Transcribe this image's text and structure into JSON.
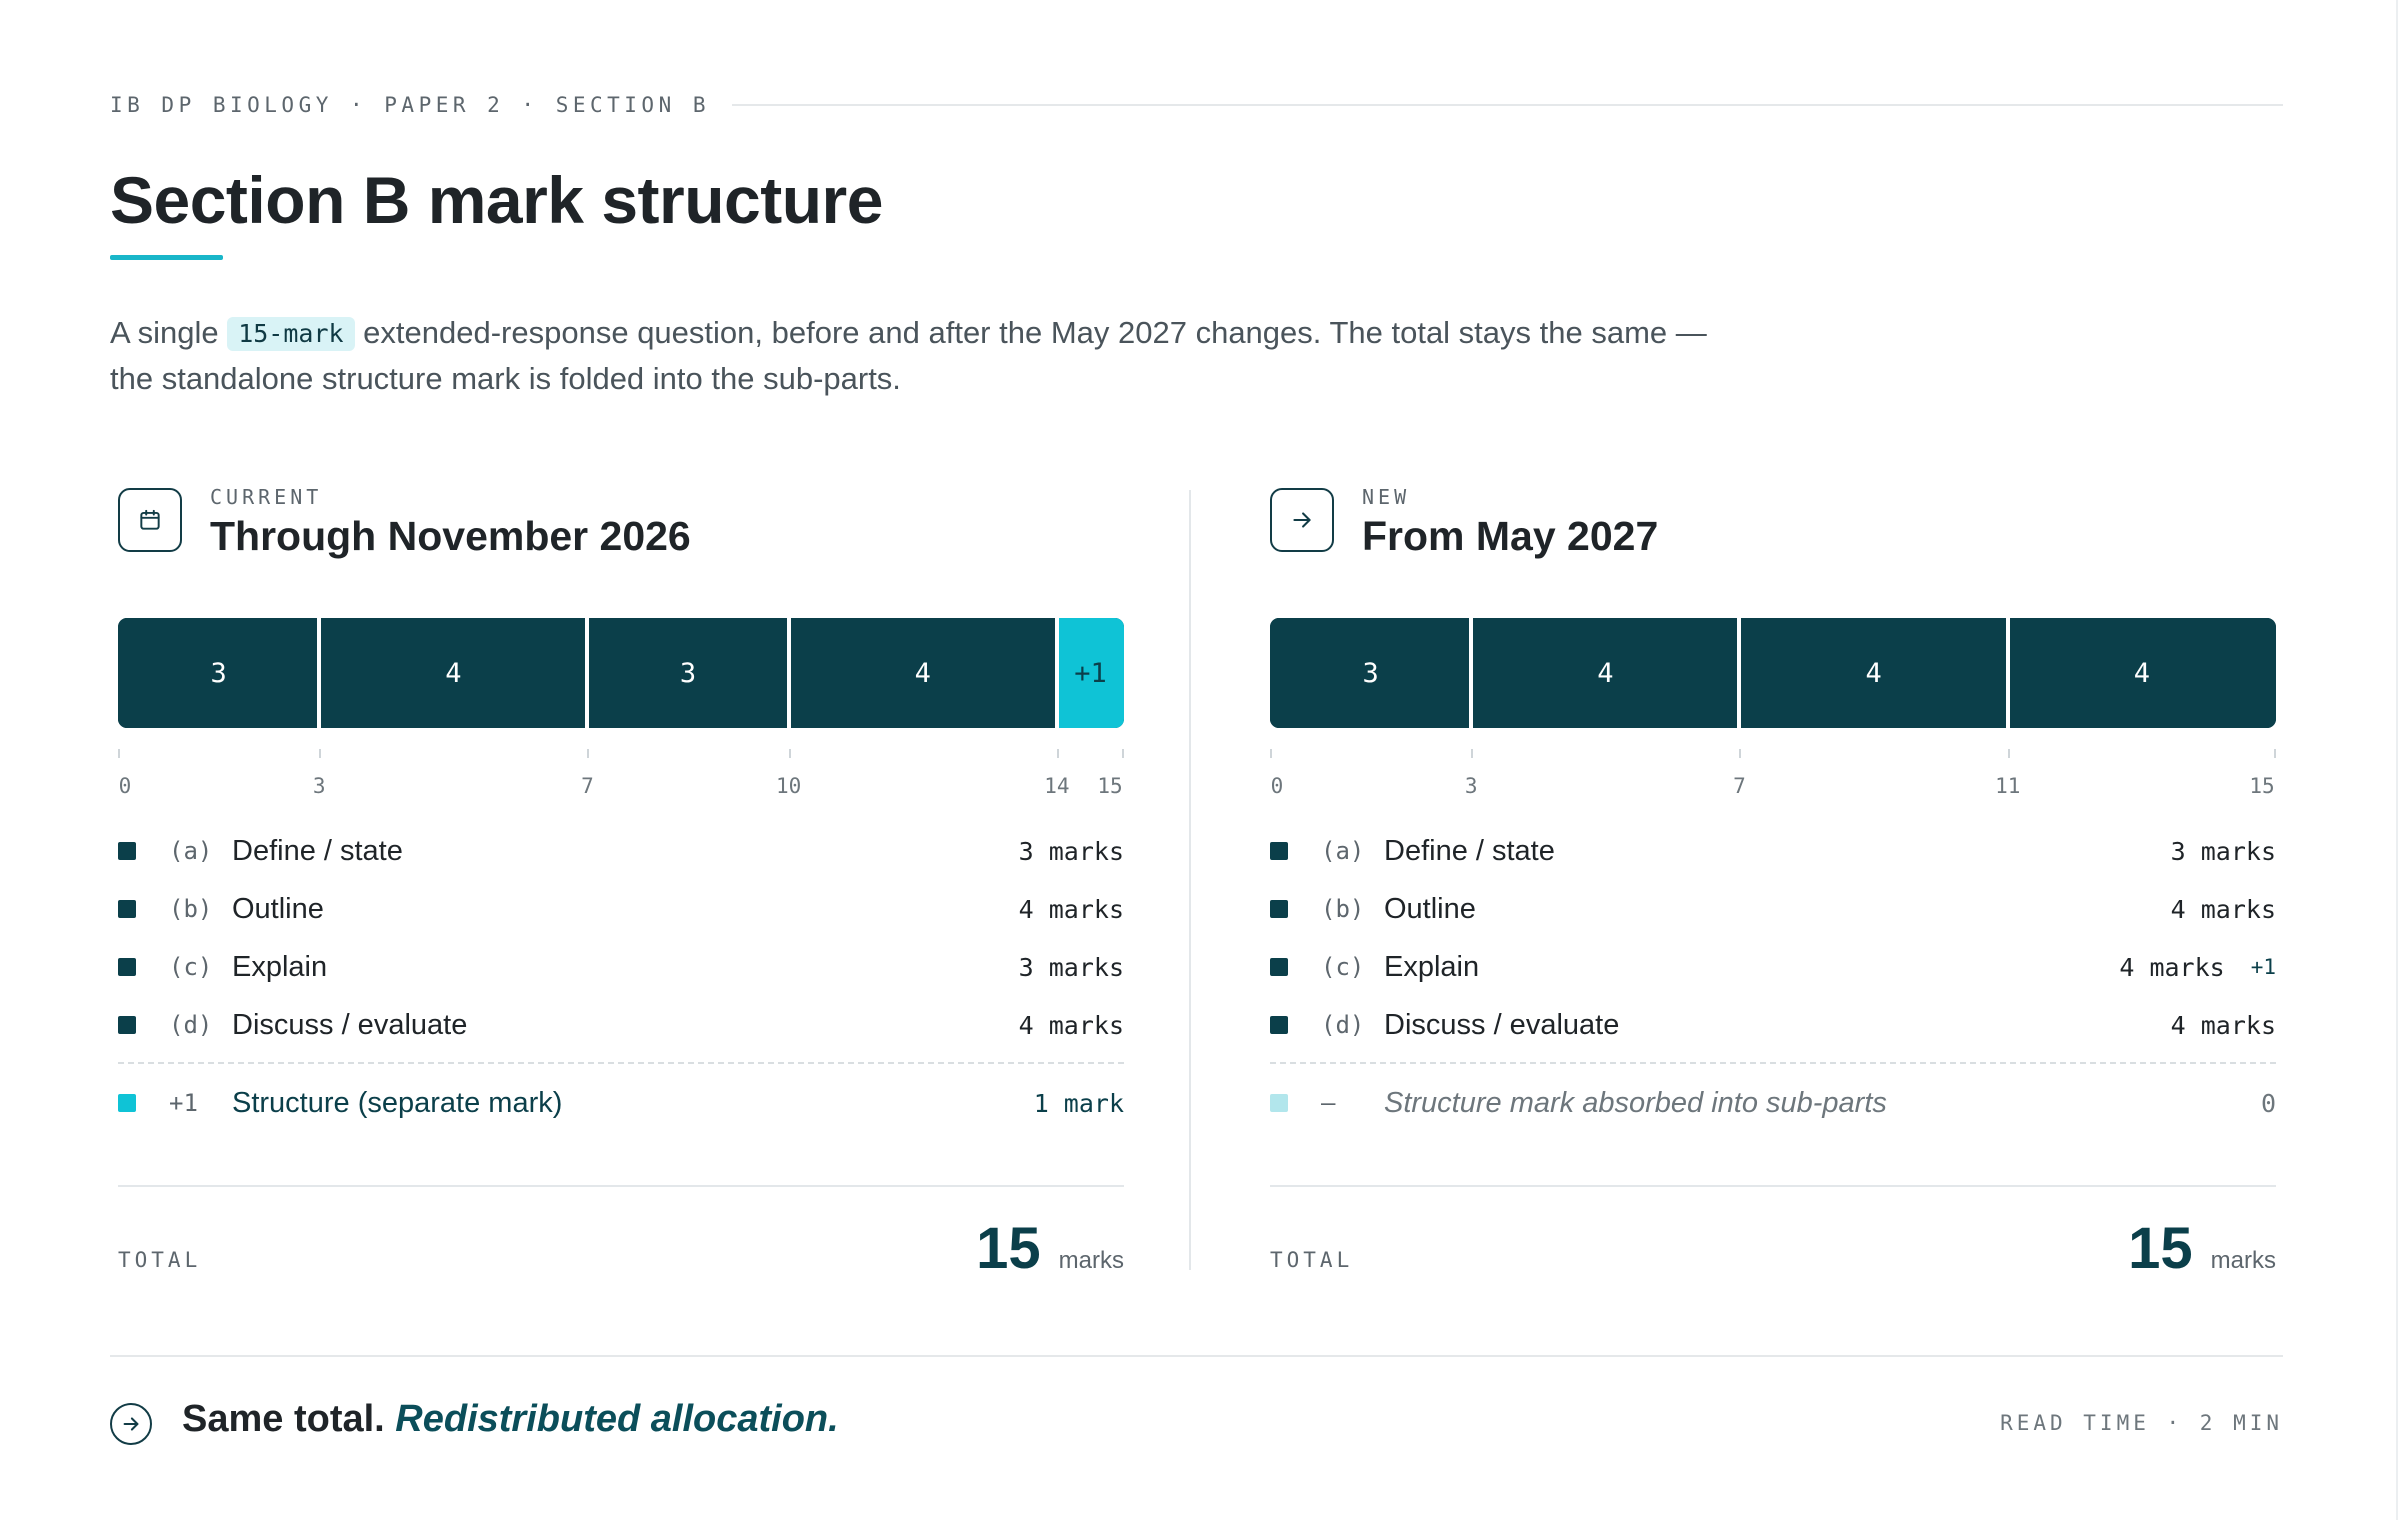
{
  "eyebrow": "IB DP BIOLOGY · PAPER 2 · SECTION B",
  "title": "Section B mark structure",
  "intro": {
    "before": "A single ",
    "chip": "15-mark",
    "after": " extended-response question, before and after the May 2027 changes. The total stays the same — the standalone structure mark is folded into the sub-parts."
  },
  "panels": {
    "current": {
      "kicker": "CURRENT",
      "title": "Through November 2026",
      "icon": "calendar-icon",
      "items": [
        {
          "code": "(a)",
          "label": "Define / state",
          "value": "3 marks"
        },
        {
          "code": "(b)",
          "label": "Outline",
          "value": "4 marks"
        },
        {
          "code": "(c)",
          "label": "Explain",
          "value": "3 marks"
        },
        {
          "code": "(d)",
          "label": "Discuss / evaluate",
          "value": "4 marks"
        }
      ],
      "extra": {
        "code": "+1",
        "label": "Structure (separate mark)",
        "value": "1 mark"
      },
      "total_label": "TOTAL",
      "total": "15",
      "total_unit": "marks"
    },
    "new": {
      "kicker": "NEW",
      "title": "From May 2027",
      "icon": "arrow-right-icon",
      "items": [
        {
          "code": "(a)",
          "label": "Define / state",
          "value": "3 marks",
          "delta": ""
        },
        {
          "code": "(b)",
          "label": "Outline",
          "value": "4 marks",
          "delta": ""
        },
        {
          "code": "(c)",
          "label": "Explain",
          "value": "4 marks",
          "delta": "+1"
        },
        {
          "code": "(d)",
          "label": "Discuss / evaluate",
          "value": "4 marks",
          "delta": ""
        }
      ],
      "extra": {
        "code": "–",
        "label": "Structure mark absorbed into sub-parts",
        "value": "0"
      },
      "total_label": "TOTAL",
      "total": "15",
      "total_unit": "marks"
    }
  },
  "chart_data": [
    {
      "type": "bar",
      "stacked": true,
      "name": "current",
      "max": 15,
      "segments": [
        {
          "label": "3",
          "value": 3
        },
        {
          "label": "4",
          "value": 4
        },
        {
          "label": "3",
          "value": 3
        },
        {
          "label": "4",
          "value": 4
        },
        {
          "label": "+1",
          "value": 1,
          "accent": true
        }
      ],
      "ticks": [
        0,
        3,
        7,
        10,
        14,
        15
      ]
    },
    {
      "type": "bar",
      "stacked": true,
      "name": "new",
      "max": 15,
      "segments": [
        {
          "label": "3",
          "value": 3
        },
        {
          "label": "4",
          "value": 4
        },
        {
          "label": "4",
          "value": 4
        },
        {
          "label": "4",
          "value": 4
        }
      ],
      "ticks": [
        0,
        3,
        7,
        11,
        15
      ]
    }
  ],
  "colors": {
    "dark": "#0b3f4a",
    "accent": "#0fc3d6",
    "pale": "#b2e6ec"
  },
  "footer": {
    "strong": "Same total.",
    "em": "Redistributed allocation.",
    "meta": "READ TIME · 2 MIN",
    "icon": "arrow-circle-icon"
  }
}
